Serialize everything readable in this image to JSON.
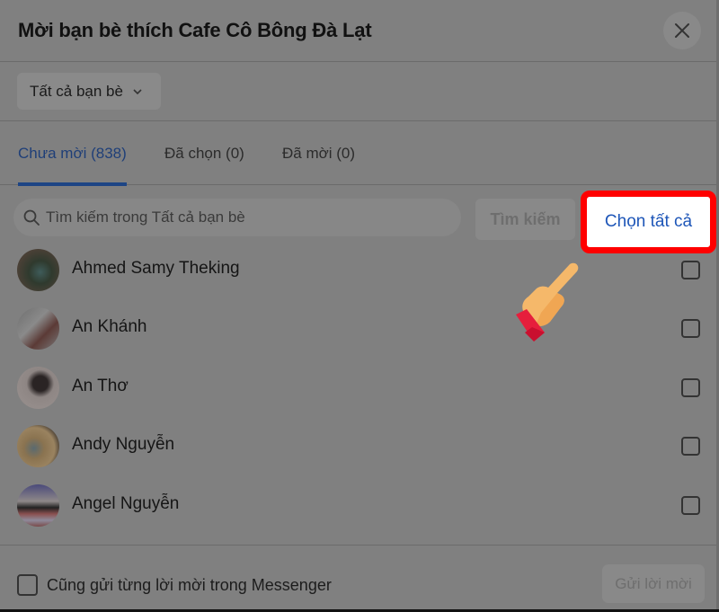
{
  "dialog": {
    "title": "Mời bạn bè thích Cafe Cô Bông Đà Lạt",
    "close_icon": "close-icon"
  },
  "filter": {
    "label": "Tất cả bạn bè",
    "icon": "chevron-down-icon"
  },
  "tabs": [
    {
      "label": "Chưa mời (838)",
      "active": true
    },
    {
      "label": "Đã chọn (0)",
      "active": false
    },
    {
      "label": "Đã mời (0)",
      "active": false
    }
  ],
  "search": {
    "placeholder": "Tìm kiếm trong Tất cả bạn bè",
    "value": "",
    "button_label": "Tìm kiếm",
    "icon": "search-icon"
  },
  "select_all_label": "Chọn tất cả",
  "friends": [
    {
      "name": "Ahmed Samy Theking",
      "checked": false
    },
    {
      "name": "An Khánh",
      "checked": false
    },
    {
      "name": "An Thơ",
      "checked": false
    },
    {
      "name": "Andy Nguyễn",
      "checked": false
    },
    {
      "name": "Angel Nguyễn",
      "checked": false
    }
  ],
  "footer": {
    "messenger_label": "Cũng gửi từng lời mời trong Messenger",
    "messenger_checked": false,
    "send_label": "Gửi lời mời"
  },
  "annotation": {
    "highlight_color": "#ff0000",
    "pointer_icon": "pointing-hand-icon"
  },
  "colors": {
    "accent": "#1e56b8",
    "overlay": "#7f7f7f"
  }
}
